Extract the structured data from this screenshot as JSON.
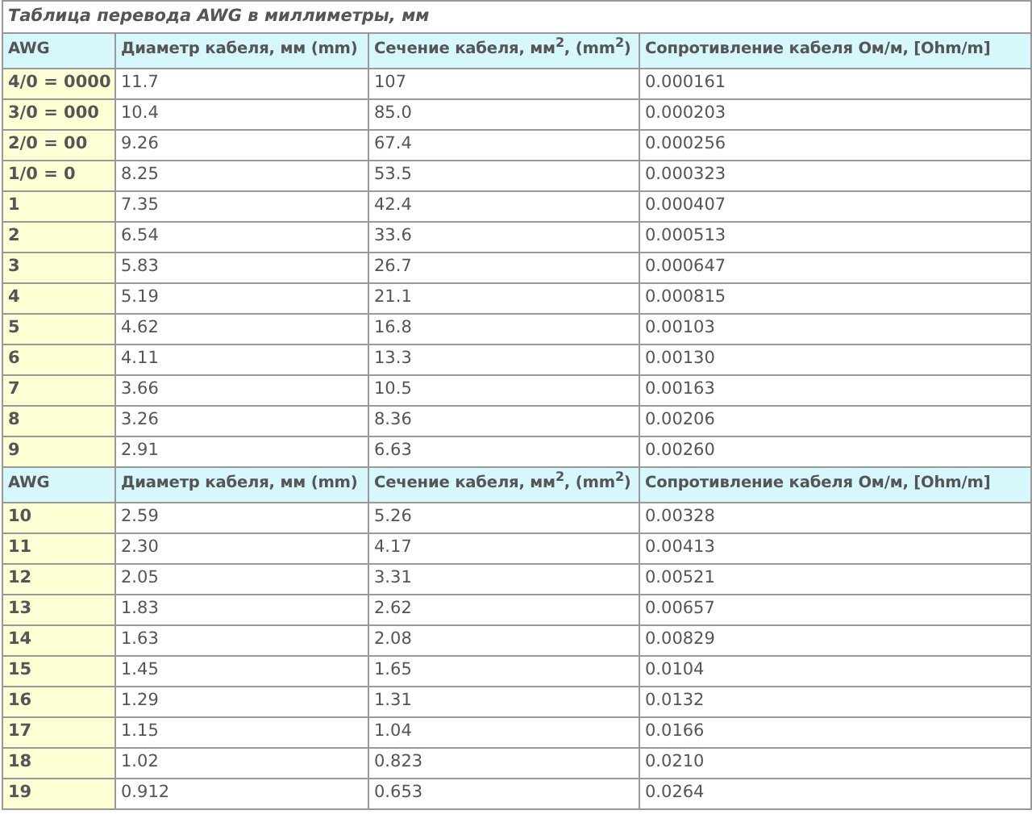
{
  "title": "Таблица перевода AWG в миллиметры, мм",
  "sections": [
    {
      "columns": [
        "AWG",
        "Диаметр кабеля, мм (mm)",
        "Сечение кабеля, мм$^{2}$, (mm$^{2}$)",
        "Сопротивление кабеля Ом/м, [Ohm/m]"
      ],
      "rows": [
        [
          "4/0 = 0000",
          "11.7",
          "107",
          "0.000161"
        ],
        [
          "3/0 = 000",
          "10.4",
          "85.0",
          "0.000203"
        ],
        [
          "2/0 = 00",
          "9.26",
          "67.4",
          "0.000256"
        ],
        [
          "1/0 = 0",
          "8.25",
          "53.5",
          "0.000323"
        ],
        [
          "1",
          "7.35",
          "42.4",
          "0.000407"
        ],
        [
          "2",
          "6.54",
          "33.6",
          "0.000513"
        ],
        [
          "3",
          "5.83",
          "26.7",
          "0.000647"
        ],
        [
          "4",
          "5.19",
          "21.1",
          "0.000815"
        ],
        [
          "5",
          "4.62",
          "16.8",
          "0.00103"
        ],
        [
          "6",
          "4.11",
          "13.3",
          "0.00130"
        ],
        [
          "7",
          "3.66",
          "10.5",
          "0.00163"
        ],
        [
          "8",
          "3.26",
          "8.36",
          "0.00206"
        ],
        [
          "9",
          "2.91",
          "6.63",
          "0.00260"
        ]
      ]
    },
    {
      "columns": [
        "AWG",
        "Диаметр кабеля, мм (mm)",
        "Сечение кабеля, мм$^{2}$, (mm$^{2}$)",
        "Сопротивление кабеля Ом/м, [Ohm/m]"
      ],
      "rows": [
        [
          "10",
          "2.59",
          "5.26",
          "0.00328"
        ],
        [
          "11",
          "2.30",
          "4.17",
          "0.00413"
        ],
        [
          "12",
          "2.05",
          "3.31",
          "0.00521"
        ],
        [
          "13",
          "1.83",
          "2.62",
          "0.00657"
        ],
        [
          "14",
          "1.63",
          "2.08",
          "0.00829"
        ],
        [
          "15",
          "1.45",
          "1.65",
          "0.0104"
        ],
        [
          "16",
          "1.29",
          "1.31",
          "0.0132"
        ],
        [
          "17",
          "1.15",
          "1.04",
          "0.0166"
        ],
        [
          "18",
          "1.02",
          "0.823",
          "0.0210"
        ],
        [
          "19",
          "0.912",
          "0.653",
          "0.0264"
        ]
      ]
    }
  ]
}
